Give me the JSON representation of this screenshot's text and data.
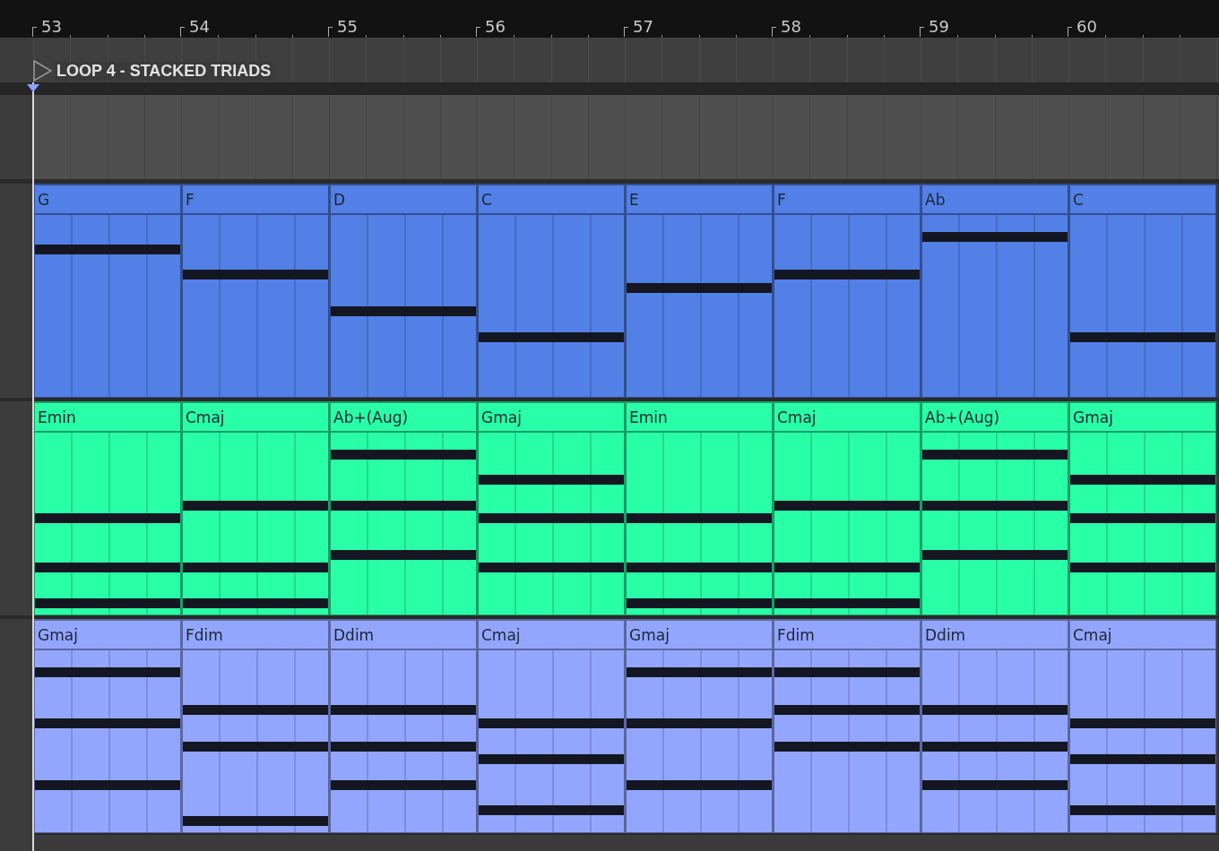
{
  "ruler": {
    "bars": [
      "53",
      "54",
      "55",
      "56",
      "57",
      "58",
      "59",
      "60"
    ]
  },
  "locator": {
    "label": "LOOP 4 - STACKED TRIADS"
  },
  "tracks": [
    {
      "color": "#5280e6",
      "clips": [
        {
          "name": "G",
          "notes": [
            {
              "level": 0.81
            }
          ]
        },
        {
          "name": "F",
          "notes": [
            {
              "level": 0.67
            }
          ]
        },
        {
          "name": "D",
          "notes": [
            {
              "level": 0.47
            }
          ]
        },
        {
          "name": "C",
          "notes": [
            {
              "level": 0.33
            }
          ]
        },
        {
          "name": "E",
          "notes": [
            {
              "level": 0.6
            }
          ]
        },
        {
          "name": "F",
          "notes": [
            {
              "level": 0.67
            }
          ]
        },
        {
          "name": "Ab",
          "notes": [
            {
              "level": 0.88
            }
          ]
        },
        {
          "name": "C",
          "notes": [
            {
              "level": 0.33
            }
          ]
        }
      ]
    },
    {
      "color": "#29ffa6",
      "clips": [
        {
          "name": "Emin",
          "notes": [
            {
              "level": 0.53
            },
            {
              "level": 0.26
            },
            {
              "level": 0.06
            }
          ]
        },
        {
          "name": "Cmaj",
          "notes": [
            {
              "level": 0.6
            },
            {
              "level": 0.26
            },
            {
              "level": 0.06
            }
          ]
        },
        {
          "name": "Ab+(Aug)",
          "notes": [
            {
              "level": 0.88
            },
            {
              "level": 0.6
            },
            {
              "level": 0.33
            }
          ]
        },
        {
          "name": "Gmaj",
          "notes": [
            {
              "level": 0.74
            },
            {
              "level": 0.53
            },
            {
              "level": 0.26
            }
          ]
        },
        {
          "name": "Emin",
          "notes": [
            {
              "level": 0.53
            },
            {
              "level": 0.26
            },
            {
              "level": 0.06
            }
          ]
        },
        {
          "name": "Cmaj",
          "notes": [
            {
              "level": 0.6
            },
            {
              "level": 0.26
            },
            {
              "level": 0.06
            }
          ]
        },
        {
          "name": "Ab+(Aug)",
          "notes": [
            {
              "level": 0.88
            },
            {
              "level": 0.6
            },
            {
              "level": 0.33
            }
          ]
        },
        {
          "name": "Gmaj",
          "notes": [
            {
              "level": 0.74
            },
            {
              "level": 0.53
            },
            {
              "level": 0.26
            }
          ]
        }
      ]
    },
    {
      "color": "#93a6ff",
      "clips": [
        {
          "name": "Gmaj",
          "notes": [
            {
              "level": 0.88
            },
            {
              "level": 0.6
            },
            {
              "level": 0.26
            }
          ]
        },
        {
          "name": "Fdim",
          "notes": [
            {
              "level": 0.67
            },
            {
              "level": 0.47
            },
            {
              "level": 0.06
            }
          ]
        },
        {
          "name": "Ddim",
          "notes": [
            {
              "level": 0.67
            },
            {
              "level": 0.47
            },
            {
              "level": 0.26
            }
          ]
        },
        {
          "name": "Cmaj",
          "notes": [
            {
              "level": 0.6
            },
            {
              "level": 0.4
            },
            {
              "level": 0.12
            }
          ]
        },
        {
          "name": "Gmaj",
          "notes": [
            {
              "level": 0.88
            },
            {
              "level": 0.6
            },
            {
              "level": 0.26
            }
          ]
        },
        {
          "name": "Fdim",
          "notes": [
            {
              "level": 0.88
            },
            {
              "level": 0.67
            },
            {
              "level": 0.47
            }
          ]
        },
        {
          "name": "Ddim",
          "notes": [
            {
              "level": 0.67
            },
            {
              "level": 0.47
            },
            {
              "level": 0.26
            }
          ]
        },
        {
          "name": "Cmaj",
          "notes": [
            {
              "level": 0.6
            },
            {
              "level": 0.4
            },
            {
              "level": 0.12
            }
          ]
        }
      ]
    }
  ]
}
